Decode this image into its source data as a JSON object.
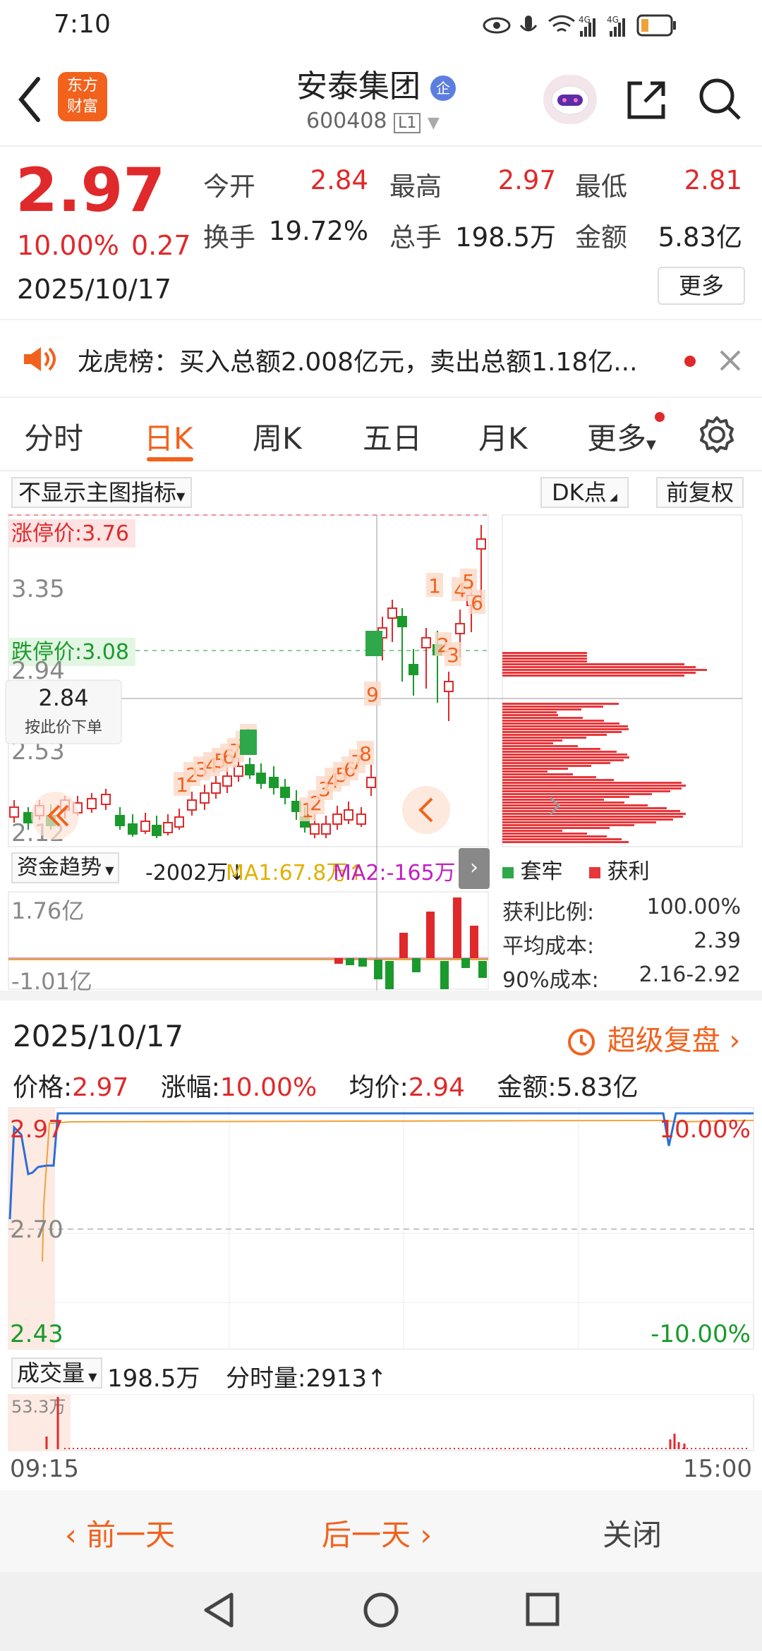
{
  "status": {
    "time": "7:10",
    "battery": "",
    "net1": "4G",
    "net2": "4G"
  },
  "header": {
    "title": "安泰集团",
    "badge": "企",
    "code": "600408",
    "level": "L1",
    "logo_line1": "东方",
    "logo_line2": "财富"
  },
  "quote": {
    "price": "2.97",
    "pct": "10.00%",
    "change": "0.27",
    "date": "2025/10/17",
    "more": "更多",
    "items": [
      {
        "label": "今开",
        "value": "2.84",
        "color": "#e0292b"
      },
      {
        "label": "最高",
        "value": "2.97",
        "color": "#e0292b"
      },
      {
        "label": "最低",
        "value": "2.81",
        "color": "#e0292b"
      },
      {
        "label": "换手",
        "value": "19.72%",
        "color": "#222"
      },
      {
        "label": "总手",
        "value": "198.5万",
        "color": "#222"
      },
      {
        "label": "金额",
        "value": "5.83亿",
        "color": "#222"
      }
    ]
  },
  "notice": {
    "text": "龙虎榜：买入总额2.008亿元，卖出总额1.18亿..."
  },
  "tabs": [
    "分时",
    "日K",
    "周K",
    "五日",
    "月K",
    "更多"
  ],
  "active_tab": "日K",
  "kchart": {
    "indicator_select": "不显示主图指标",
    "dk": "DK点",
    "adjust": "前复权",
    "limit_up": "涨停价:3.76",
    "limit_down": "跌停价:3.08",
    "y_labels": [
      "3.35",
      "2.94",
      "2.53",
      "2.12"
    ],
    "cursor_price": "2.84",
    "cursor_hint": "按此价下单",
    "seq_numbers_a": [
      "1",
      "2",
      "3",
      "4",
      "5",
      "6",
      "7",
      "8",
      "9"
    ],
    "seq_numbers_b": [
      "1",
      "2",
      "3",
      "4",
      "5",
      "6",
      "7",
      "8",
      "9"
    ],
    "seq_numbers_c": [
      "1",
      "2",
      "3",
      "4",
      "5",
      "6"
    ]
  },
  "chips": {
    "legend_trap": "套牢",
    "legend_profit": "获利",
    "rows": [
      {
        "label": "获利比例:",
        "value": "100.00%"
      },
      {
        "label": "平均成本:",
        "value": "2.39"
      },
      {
        "label": "90%成本:",
        "value": "2.16-2.92"
      }
    ],
    "colors": {
      "trap": "#2ea84a",
      "profit": "#e8363a"
    }
  },
  "fund": {
    "select": "资金趋势",
    "value": "-2002万↓",
    "ma1": "MA1:67.8万↑",
    "ma2": "MA2:-165万↓",
    "top": "1.76亿",
    "bottom": "-1.01亿"
  },
  "replay": {
    "date": "2025/10/17",
    "link": "超级复盘",
    "price_label": "价格:",
    "price": "2.97",
    "pct_label": "涨幅:",
    "pct": "10.00%",
    "avg_label": "均价:",
    "avg": "2.94",
    "amt_label": "金额:",
    "amt": "5.83亿",
    "y_top": "2.97",
    "y_mid": "2.70",
    "y_bot": "2.43",
    "r_top": "10.00%",
    "r_bot": "-10.00%",
    "vol_select": "成交量",
    "vol": "198.5万",
    "minute_vol": "分时量:2913↑",
    "vol_max": "53.3万",
    "t_start": "09:15",
    "t_end": "15:00"
  },
  "bottom": {
    "prev": "前一天",
    "next": "后一天",
    "close": "关闭"
  }
}
